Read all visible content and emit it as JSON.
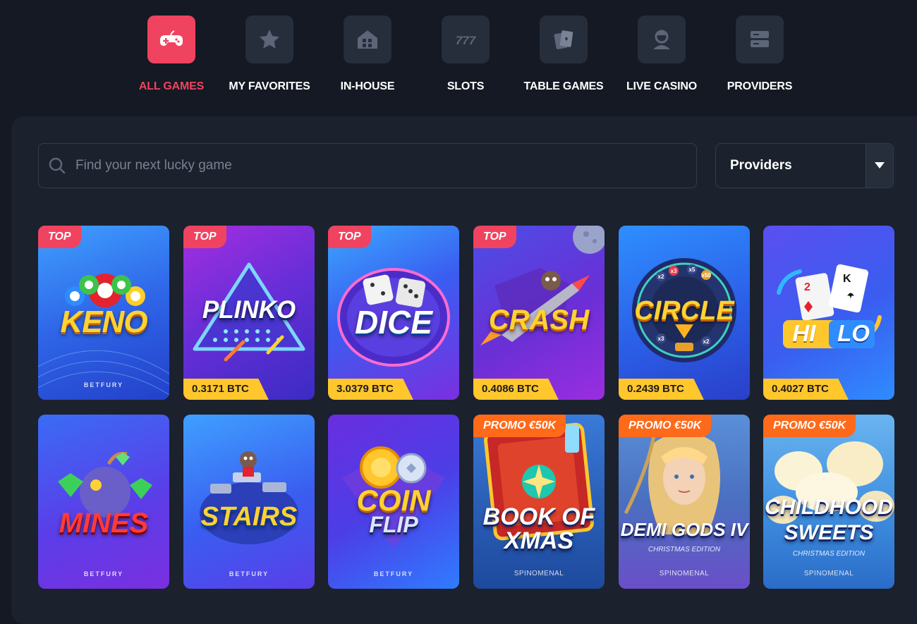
{
  "nav": {
    "items": [
      {
        "label": "ALL GAMES",
        "icon": "gamepad-icon",
        "active": true
      },
      {
        "label": "MY FAVORITES",
        "icon": "star-icon"
      },
      {
        "label": "IN-HOUSE",
        "icon": "house-icon"
      },
      {
        "label": "SLOTS",
        "icon": "777-icon"
      },
      {
        "label": "TABLE GAMES",
        "icon": "cards-icon"
      },
      {
        "label": "LIVE CASINO",
        "icon": "dealer-icon"
      },
      {
        "label": "PROVIDERS",
        "icon": "server-icon"
      }
    ]
  },
  "search": {
    "placeholder": "Find your next lucky game"
  },
  "providers_select": {
    "label": "Providers"
  },
  "colors": {
    "accent": "#f0435f",
    "promo": "#ff6a1a",
    "jackpot": "#ffc72c",
    "page_bg": "#141923",
    "panel_bg": "#1b212d"
  },
  "games": [
    {
      "title": "KENO",
      "badge": "TOP",
      "provider": "BETFURY"
    },
    {
      "title": "PLINKO",
      "badge": "TOP",
      "jackpot": "0.3171 BTC"
    },
    {
      "title": "DICE",
      "badge": "TOP",
      "jackpot": "3.0379 BTC"
    },
    {
      "title": "CRASH",
      "badge": "TOP",
      "jackpot": "0.4086 BTC"
    },
    {
      "title": "CIRCLE",
      "jackpot": "0.2439 BTC"
    },
    {
      "title_a": "HI",
      "title_b": "LO",
      "jackpot": "0.4027 BTC"
    },
    {
      "title": "MINES",
      "provider": "BETFURY"
    },
    {
      "title": "STAIRS",
      "provider": "BETFURY"
    },
    {
      "title_a": "COIN",
      "title_b": "FLIP",
      "provider": "BETFURY"
    },
    {
      "title_a": "BOOK OF",
      "title_b": "XMAS",
      "badge": "PROMO €50K",
      "provider": "SPINOMENAL"
    },
    {
      "title": "DEMI GODS IV",
      "subtitle": "CHRISTMAS EDITION",
      "badge": "PROMO €50K",
      "provider": "SPINOMENAL"
    },
    {
      "title_a": "CHILDHOOD",
      "title_b": "SWEETS",
      "subtitle": "CHRISTMAS EDITION",
      "badge": "PROMO €50K",
      "provider": "SPINOMENAL"
    }
  ]
}
